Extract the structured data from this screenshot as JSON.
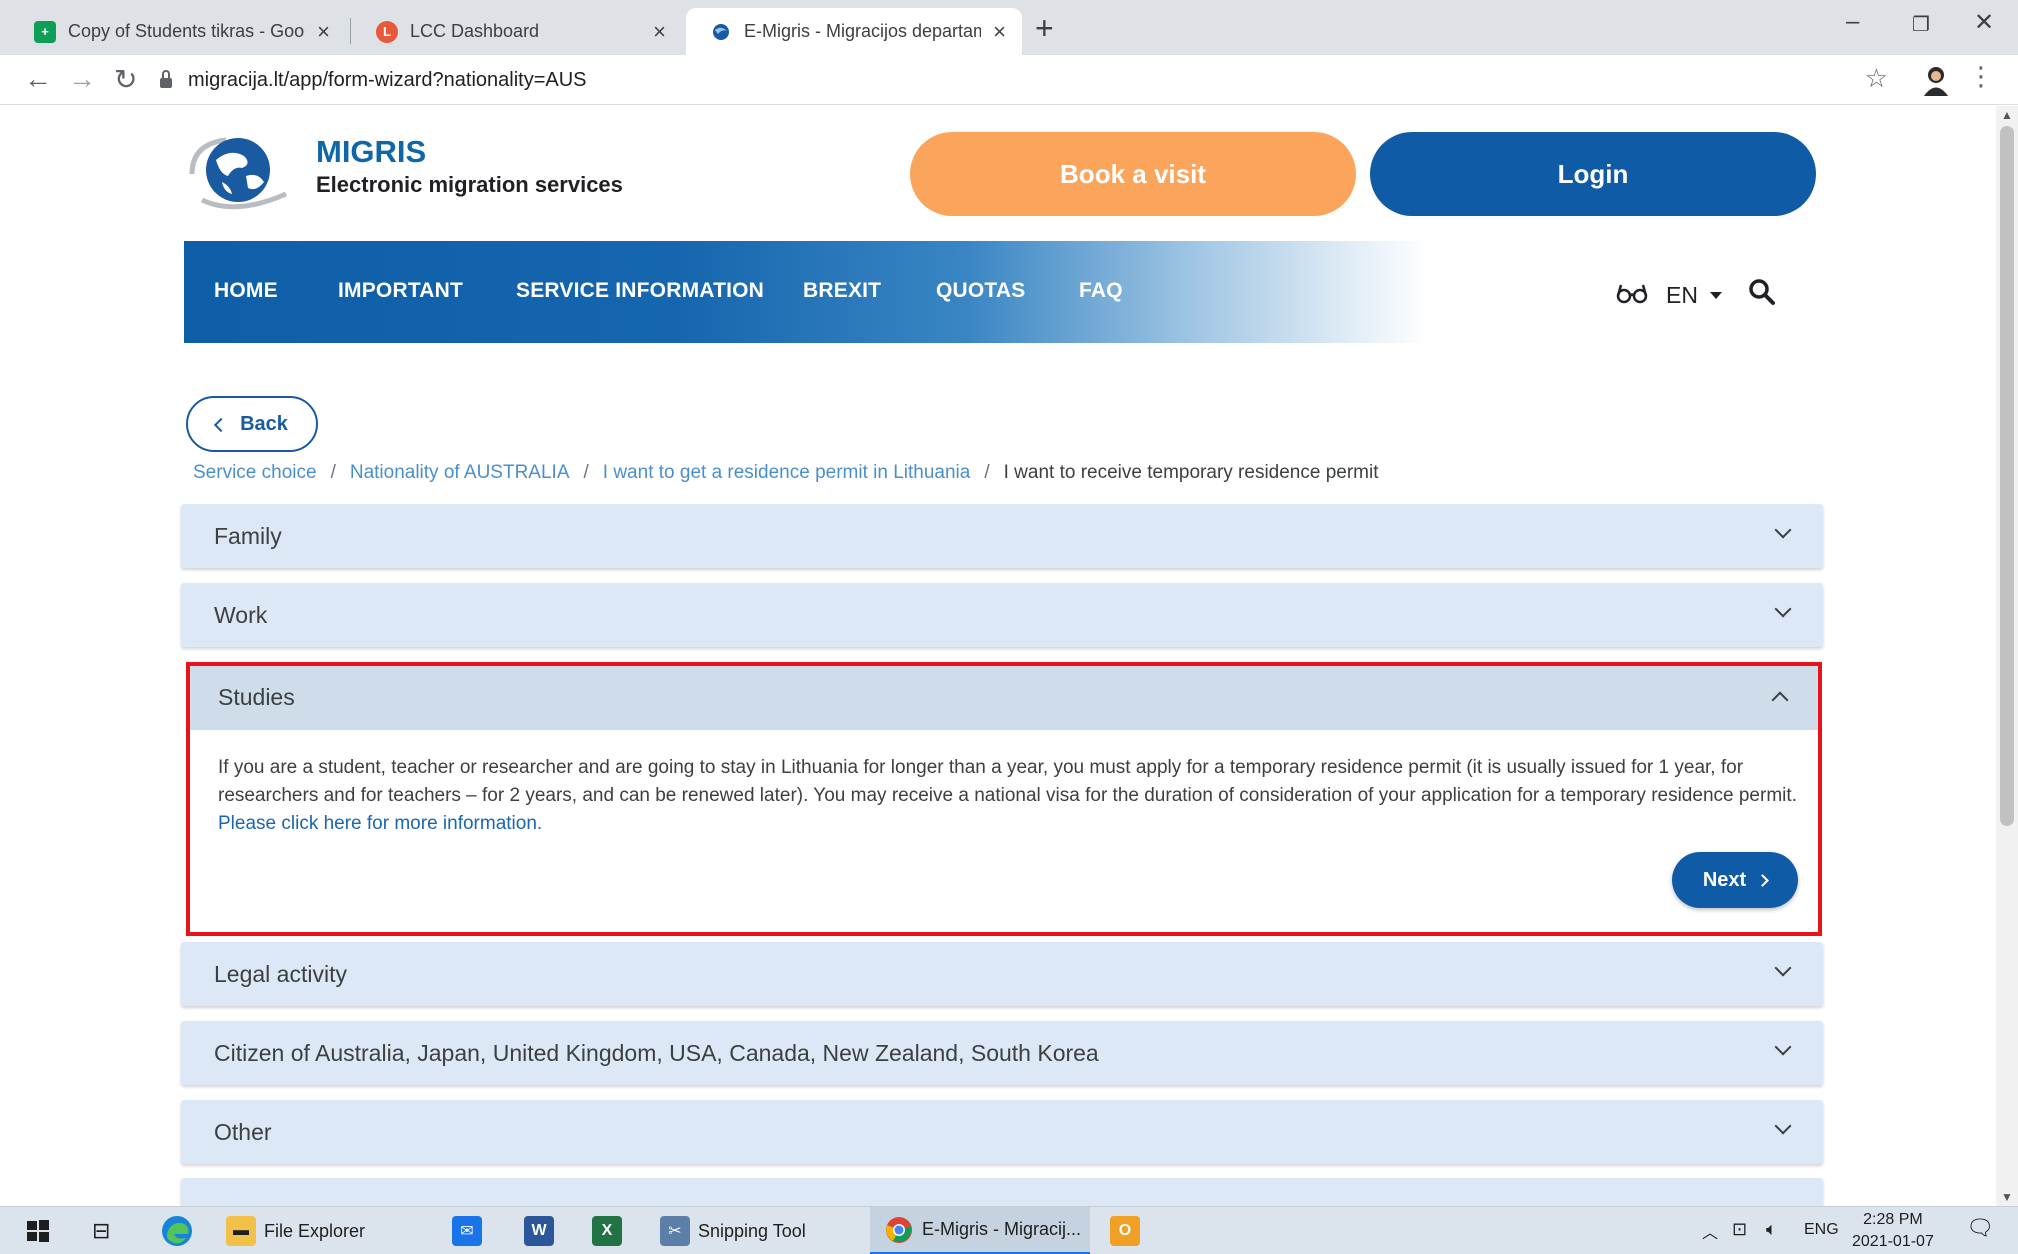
{
  "browser": {
    "tabs": [
      {
        "title": "Copy of Students tikras - Google",
        "icon": "sheets-icon",
        "color": "#0f9d58"
      },
      {
        "title": "LCC Dashboard",
        "icon": "lcc-icon",
        "color": "#e8593c"
      },
      {
        "title": "E-Migris - Migracijos departame",
        "icon": "migris-icon",
        "color": "#1a5aa0"
      }
    ],
    "url": "migracija.lt/app/form-wizard?nationality=AUS"
  },
  "header": {
    "brand_title": "MIGRIS",
    "brand_subtitle": "Electronic migration services",
    "book_label": "Book a visit",
    "login_label": "Login"
  },
  "nav": {
    "items": [
      "HOME",
      "IMPORTANT",
      "SERVICE INFORMATION",
      "BREXIT",
      "QUOTAS",
      "FAQ"
    ],
    "lang": "EN"
  },
  "back_label": "Back",
  "breadcrumb": {
    "items": [
      "Service choice",
      "Nationality of AUSTRALIA",
      "I want to get a residence permit in Lithuania"
    ],
    "current": "I want to receive temporary residence permit"
  },
  "accordion": {
    "items": [
      "Family",
      "Work",
      "Studies",
      "Legal activity",
      "Citizen of Australia, Japan, United Kingdom, USA, Canada, New Zealand, South Korea",
      "Other"
    ],
    "open_index": 2,
    "open_text": "If you are a student, teacher or researcher and are going to stay in Lithuania for longer than a year, you must apply for a temporary residence permit (it is usually issued for 1 year, for researchers and for teachers – for 2 years, and can be renewed later). You may receive a national visa for the duration of consideration of your application for a temporary residence permit.",
    "open_link": "Please click here for more information.",
    "next_label": "Next"
  },
  "taskbar": {
    "items": [
      "File Explorer",
      "Snipping Tool",
      "E-Migris - Migracij..."
    ],
    "lang": "ENG",
    "time": "2:28 PM",
    "date": "2021-01-07"
  },
  "colors": {
    "accent": "#0f5ba6",
    "book": "#fba55c",
    "highlight": "#e8141b"
  }
}
